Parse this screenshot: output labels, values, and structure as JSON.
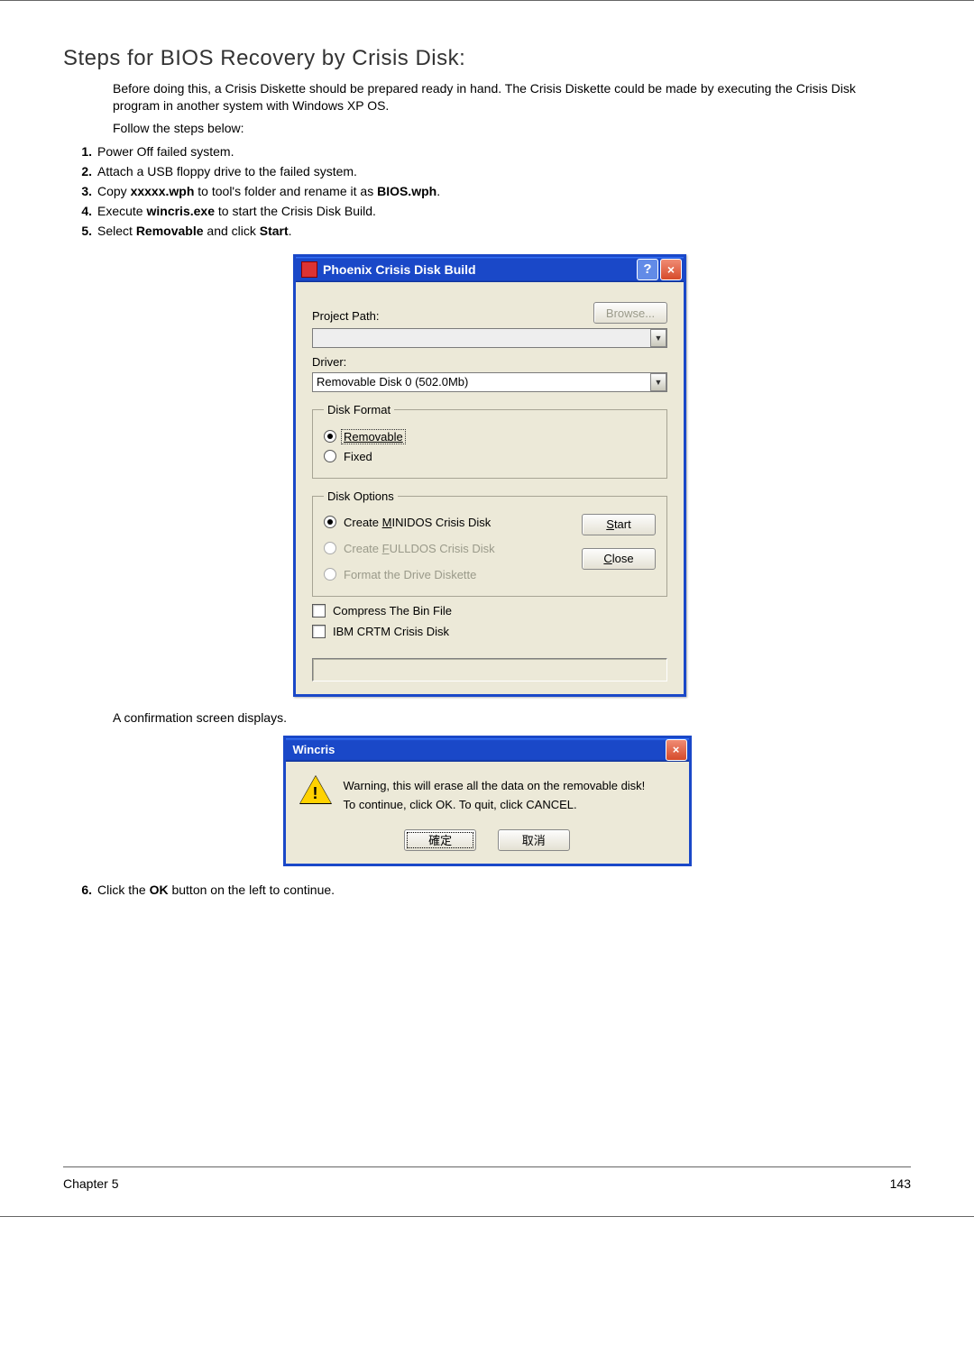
{
  "doc": {
    "heading": "Steps for BIOS Recovery by Crisis Disk:",
    "intro": "Before doing this, a Crisis Diskette should be prepared ready in hand. The Crisis Diskette could be made by executing the Crisis Disk program in another system with Windows XP OS.",
    "follow": "Follow the steps below:",
    "steps": {
      "n1": "1.",
      "s1": "Power Off failed system.",
      "n2": "2.",
      "s2": "Attach a USB floppy drive to the failed system.",
      "n3": "3.",
      "s3a": "Copy ",
      "s3b": "xxxxx.wph",
      "s3c": " to tool's folder and rename it as ",
      "s3d": "BIOS.wph",
      "s3e": ".",
      "n4": "4.",
      "s4a": "Execute ",
      "s4b": "wincris.exe",
      "s4c": " to start the Crisis Disk Build.",
      "n5": "5.",
      "s5a": "Select ",
      "s5b": "Removable",
      "s5c": " and click ",
      "s5d": "Start",
      "s5e": ".",
      "n6": "6.",
      "s6a": "Click the ",
      "s6b": "OK",
      "s6c": " button on the left to continue."
    },
    "after_first_shot": "A confirmation screen displays.",
    "footer_left": "Chapter 5",
    "footer_right": "143"
  },
  "dialog1": {
    "title": "Phoenix Crisis Disk Build",
    "project_path_label": "Project Path:",
    "browse": "Browse...",
    "project_path_value": "",
    "driver_label": "Driver:",
    "driver_value": "Removable Disk 0 (502.0Mb)",
    "grp_format": "Disk Format",
    "fmt_removable": "Removable",
    "fmt_fixed": "Fixed",
    "grp_options": "Disk Options",
    "opt_minidos_pre": "Create ",
    "opt_minidos_u": "M",
    "opt_minidos_post": "INIDOS Crisis Disk",
    "opt_fulldos_pre": "Create ",
    "opt_fulldos_u": "F",
    "opt_fulldos_post": "ULLDOS Crisis Disk",
    "opt_format": "Format the Drive Diskette",
    "start_u": "S",
    "start_post": "tart",
    "close_u": "C",
    "close_post": "lose",
    "chk_compress": "Compress The Bin File",
    "chk_ibm": "IBM CRTM Crisis Disk"
  },
  "dialog2": {
    "title": "Wincris",
    "line1": "Warning, this will erase all the data on the removable disk!",
    "line2": "To continue, click OK. To quit, click CANCEL.",
    "ok": "確定",
    "cancel": "取消"
  }
}
